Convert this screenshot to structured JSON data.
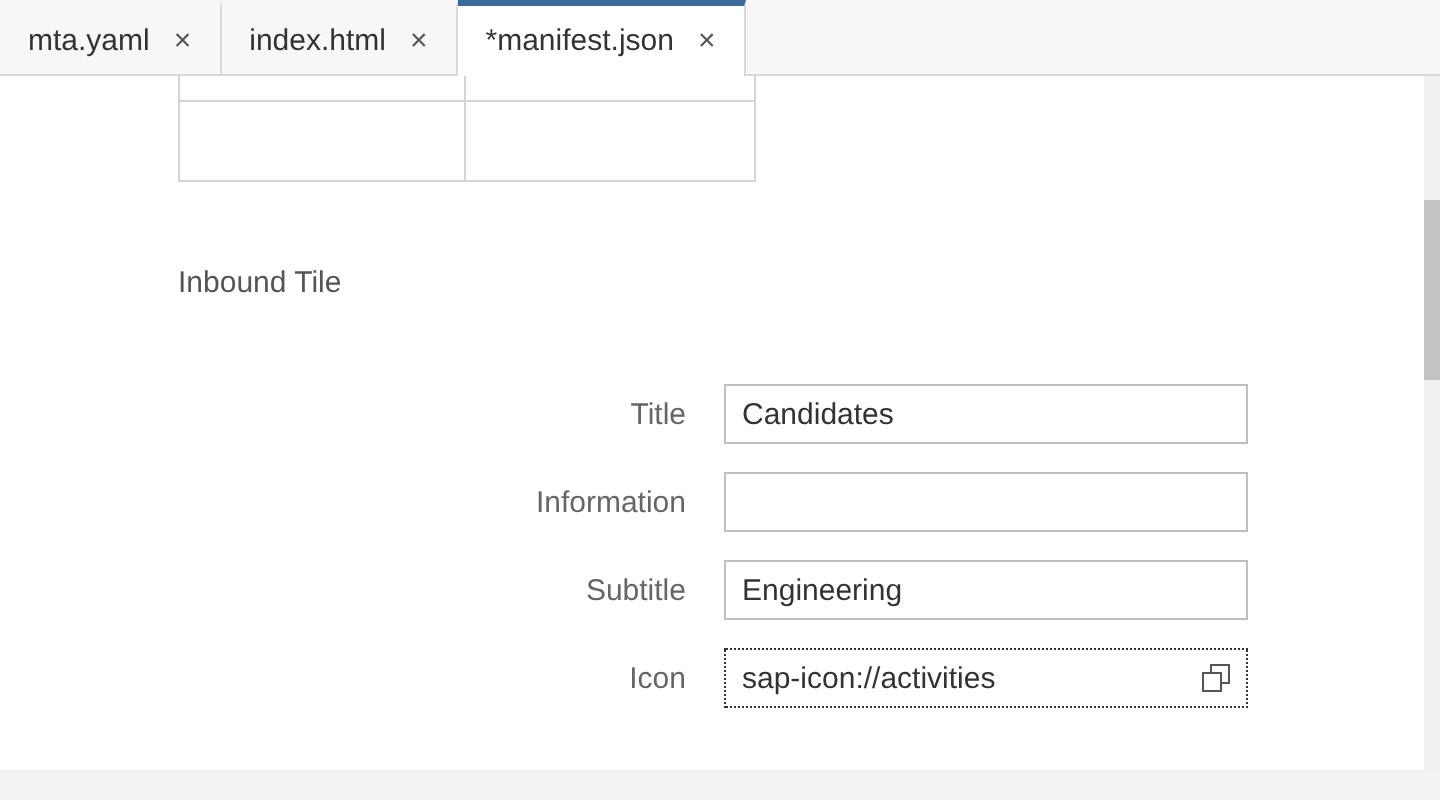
{
  "tabs": [
    {
      "label": "mta.yaml",
      "close": "×",
      "selected": false
    },
    {
      "label": "index.html",
      "close": "×",
      "selected": false
    },
    {
      "label": "*manifest.json",
      "close": "×",
      "selected": true
    }
  ],
  "table": {
    "rows": [
      [
        "",
        ""
      ],
      [
        "",
        ""
      ]
    ]
  },
  "section": {
    "title": "Inbound Tile"
  },
  "fields": [
    {
      "label": "Title",
      "value": "Candidates",
      "focused": false,
      "value_help": false
    },
    {
      "label": "Information",
      "focused": false,
      "value_help": false
    },
    {
      "label": "Subtitle",
      "value": "Engineering",
      "focused": false,
      "value_help": false
    },
    {
      "label": "Icon",
      "value": "sap-icon://activities",
      "focused": true,
      "value_help": true
    }
  ]
}
